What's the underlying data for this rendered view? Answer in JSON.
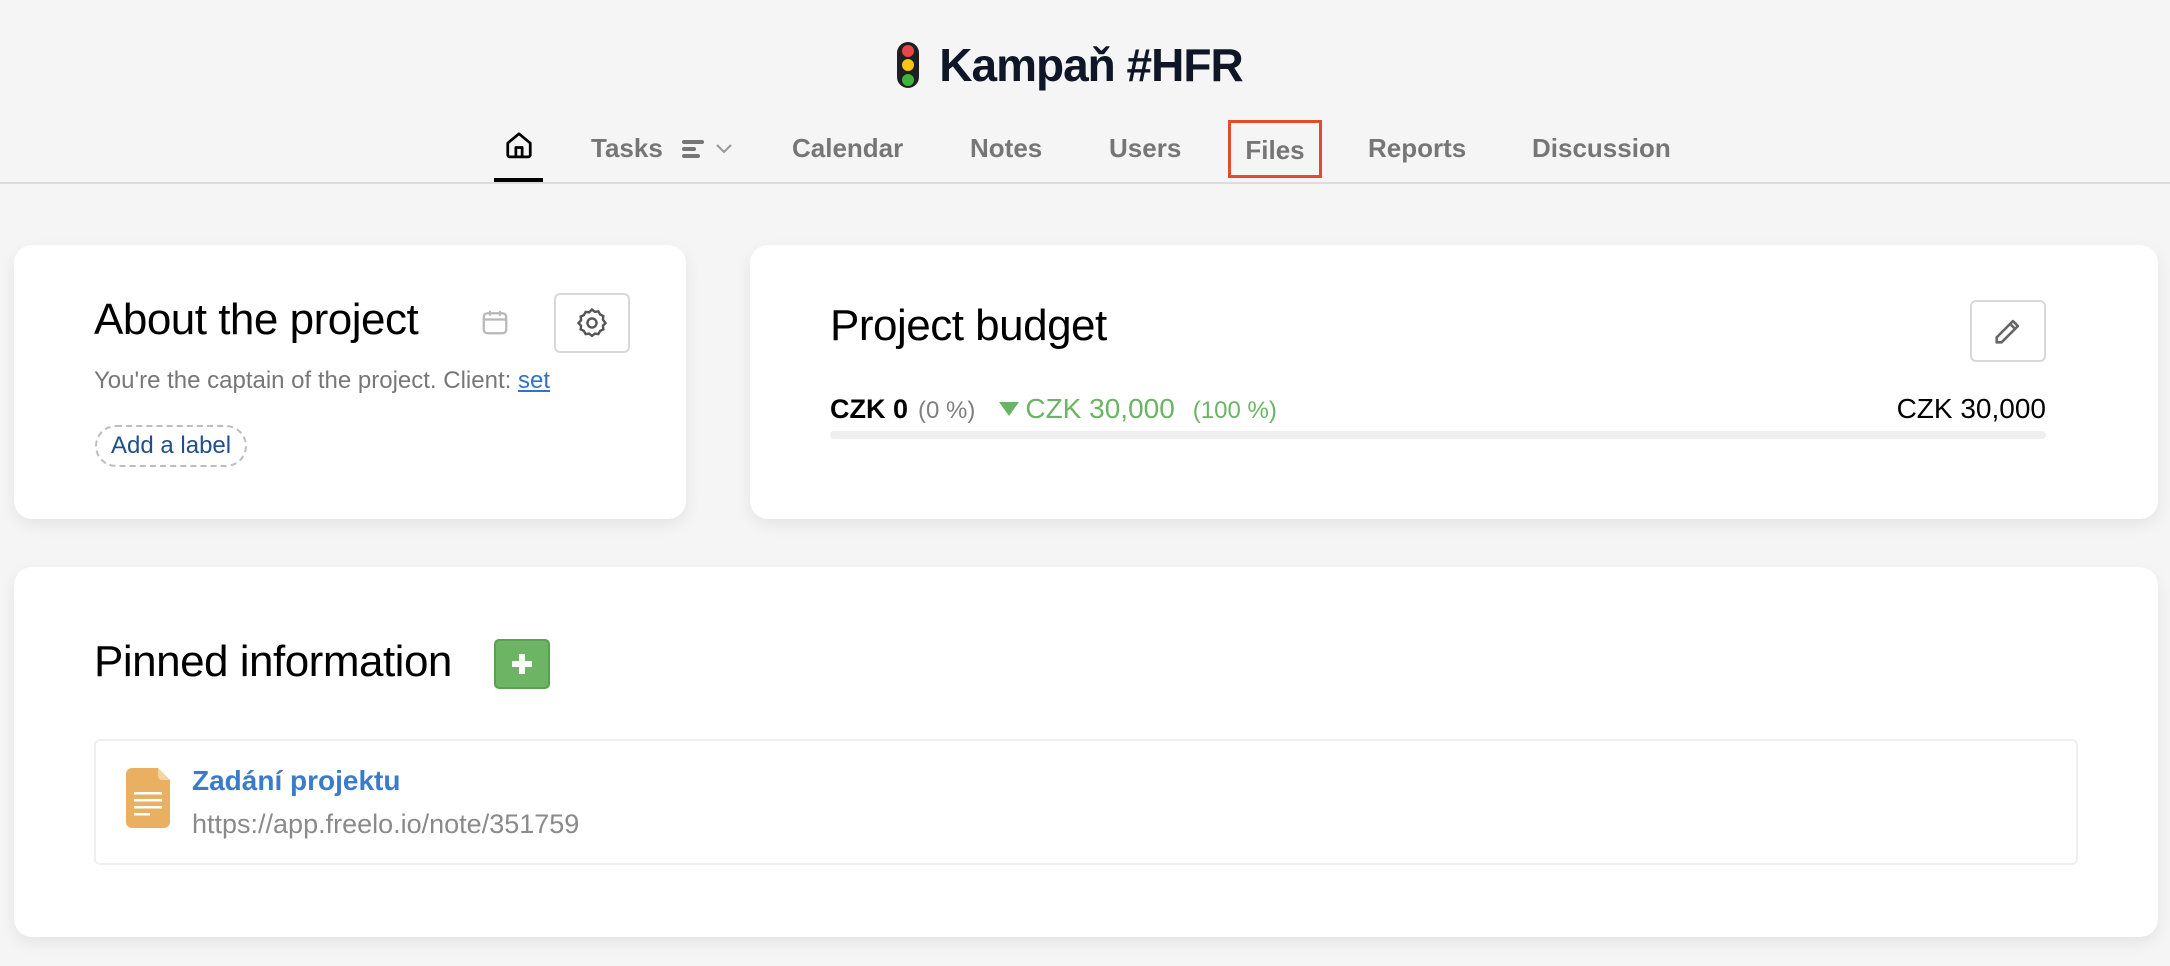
{
  "header": {
    "project_icon": "traffic-light-icon",
    "title": "Kampaň #HFR"
  },
  "nav": {
    "tabs": [
      {
        "id": "home",
        "label": "",
        "icon": "home-icon",
        "active": true
      },
      {
        "id": "tasks",
        "label": "Tasks",
        "icon": "list-view-icon",
        "has_dropdown": true
      },
      {
        "id": "calendar",
        "label": "Calendar"
      },
      {
        "id": "notes",
        "label": "Notes"
      },
      {
        "id": "users",
        "label": "Users"
      },
      {
        "id": "files",
        "label": "Files",
        "highlighted": true
      },
      {
        "id": "reports",
        "label": "Reports"
      },
      {
        "id": "discussion",
        "label": "Discussion"
      }
    ]
  },
  "about": {
    "title": "About the project",
    "calendar_icon": "calendar-icon",
    "settings_icon": "gear-icon",
    "description": "You're the captain of the project. Client: ",
    "client_link": "set",
    "add_label": "Add a label"
  },
  "budget": {
    "title": "Project budget",
    "edit_icon": "pencil-icon",
    "spent": "CZK 0",
    "spent_percent": "(0 %)",
    "remaining": "CZK 30,000",
    "remaining_percent": "(100 %)",
    "total": "CZK 30,000",
    "spent_fraction": 0,
    "colors": {
      "remaining": "#6ab563"
    }
  },
  "pinned": {
    "title": "Pinned information",
    "add_icon": "plus-icon",
    "items": [
      {
        "icon": "document-icon",
        "name": "Zadání projektu",
        "url": "https://app.freelo.io/note/351759"
      }
    ]
  },
  "colors": {
    "accent_link": "#2f74c6",
    "add_green": "#6db564",
    "highlight_box": "#e54a2c",
    "doc_icon": "#e8b060"
  }
}
